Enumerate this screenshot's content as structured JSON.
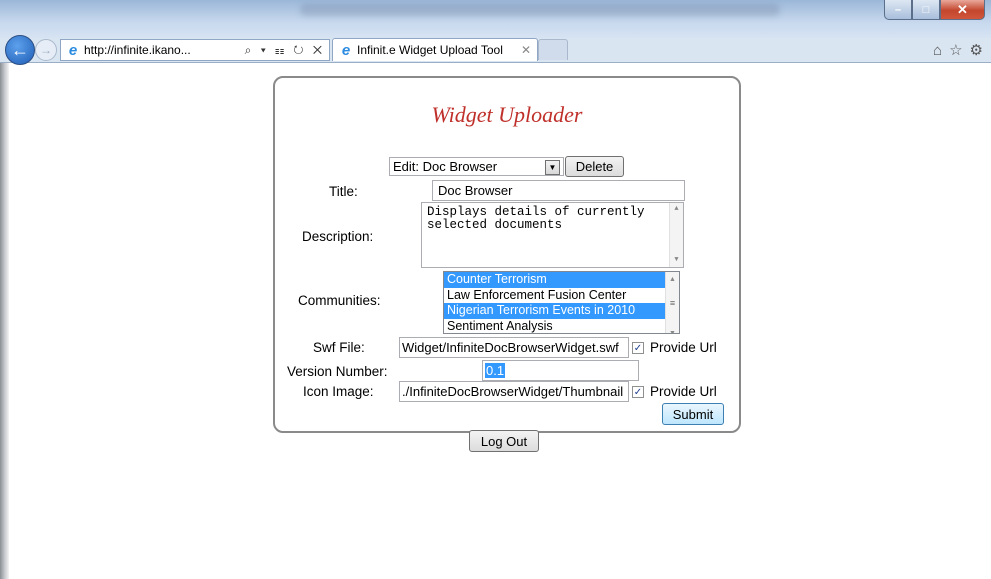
{
  "browser": {
    "address_url": "http://infinite.ikano...",
    "address_tools": "⌕ ▾ ☷ ↻ ✕",
    "tab_title": "Infinit.e Widget Upload Tool",
    "tab_close": "✕",
    "window_minimize": "–",
    "window_maximize": "□",
    "window_close": "✕"
  },
  "form": {
    "heading": "Widget Uploader",
    "widget_select_value": "Edit: Doc Browser",
    "delete_label": "Delete",
    "title_label": "Title:",
    "title_value": "Doc Browser",
    "description_label": "Description:",
    "description_value": "Displays details of currently selected documents",
    "communities_label": "Communities:",
    "communities": [
      {
        "name": "Counter Terrorism",
        "selected": true
      },
      {
        "name": "Law Enforcement Fusion Center",
        "selected": false
      },
      {
        "name": "Nigerian Terrorism Events in 2010",
        "selected": true
      },
      {
        "name": "Sentiment Analysis",
        "selected": false
      }
    ],
    "swf_label": "Swf File:",
    "swf_value": "Widget/InfiniteDocBrowserWidget.swf",
    "swf_provide_url_label": "Provide Url",
    "swf_provide_url_checked": true,
    "version_label": "Version Number:",
    "version_value": "0.1",
    "icon_label": "Icon Image:",
    "icon_value": "./InfiniteDocBrowserWidget/Thumbnail",
    "icon_provide_url_label": "Provide Url",
    "icon_provide_url_checked": true,
    "submit_label": "Submit"
  },
  "logout_label": "Log Out",
  "colors": {
    "heading": "#c0302b",
    "selection": "#3399ff"
  }
}
